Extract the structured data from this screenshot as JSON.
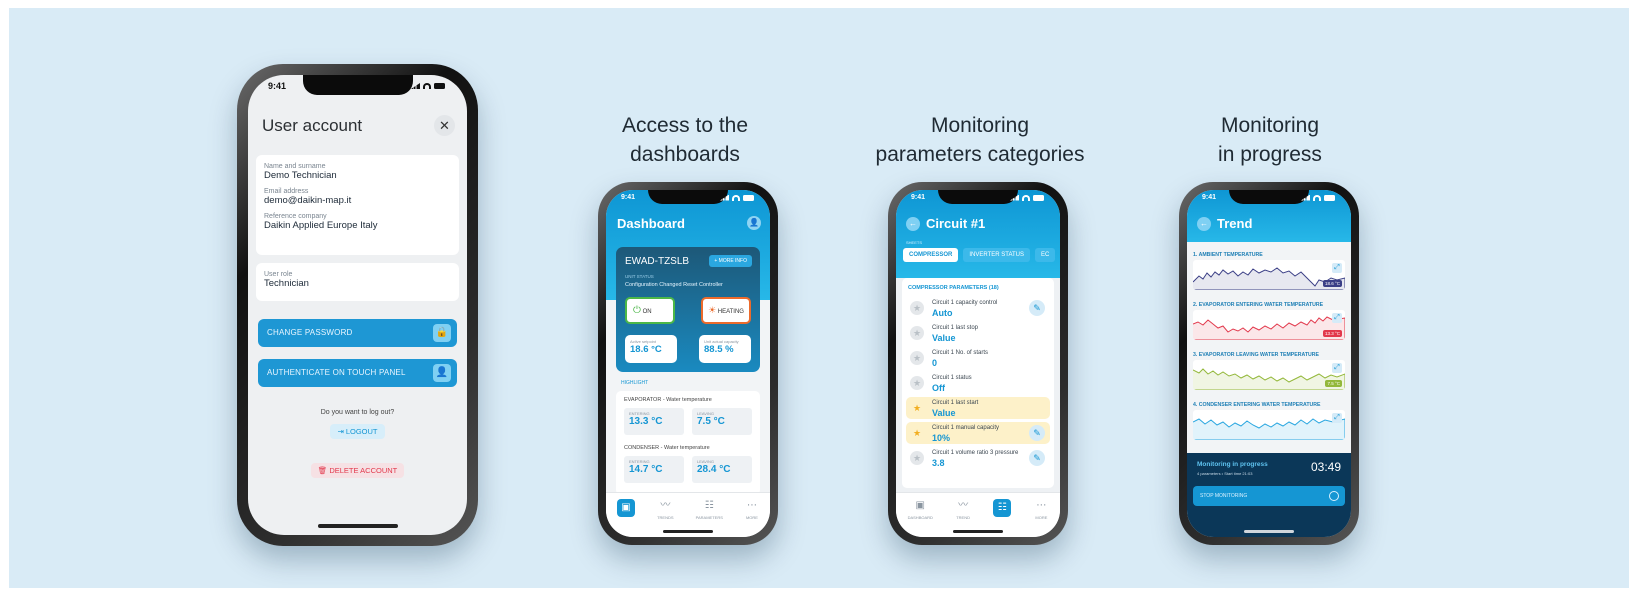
{
  "captions": {
    "c2": [
      "Access to the",
      "dashboards"
    ],
    "c3": [
      "Monitoring",
      "parameters categories"
    ],
    "c4": [
      "Monitoring",
      "in progress"
    ]
  },
  "colors": {
    "background": "#d9ebf6",
    "accent": "#1596d3",
    "danger": "#e2384c",
    "favorite": "#fdf1c9"
  },
  "phone1": {
    "time": "9:41",
    "title": "User account",
    "close_icon": "close-icon",
    "fields": [
      {
        "label": "Name and surname",
        "value": "Demo Technician"
      },
      {
        "label": "Email address",
        "value": "demo@daikin-map.it"
      },
      {
        "label": "Reference company",
        "value": "Daikin Applied Europe Italy"
      }
    ],
    "role": {
      "label": "User role",
      "value": "Technician"
    },
    "change_password": "CHANGE PASSWORD",
    "authenticate": "AUTHENTICATE ON TOUCH PANEL",
    "logout_question": "Do you want to log out?",
    "logout": "LOGOUT",
    "delete_account": "DELETE ACCOUNT"
  },
  "phone2": {
    "time": "9:41",
    "title": "Dashboard",
    "unit_name": "EWAD-TZSLB",
    "more_info": "+ MORE INFO",
    "unit_status_label": "UNIT STATUS",
    "unit_status": "Configuration Changed Reset Controller",
    "on": "ON",
    "heating": "HEATING",
    "active_setpoint_label": "Active setpoint",
    "active_setpoint": "18.6 °C",
    "capacity_label": "Unit actual capacity",
    "capacity": "88.5 %",
    "highlight": "HIGHLIGHT",
    "evaporator_title": "EVAPORATOR - Water temperature",
    "entering_label": "ENTERING",
    "leaving_label": "LEAVING",
    "evap_entering": "13.3 °C",
    "evap_leaving": "7.5 °C",
    "condenser_title": "CONDENSER - Water temperature",
    "cond_entering": "14.7 °C",
    "cond_leaving": "28.4 °C",
    "nav": [
      "",
      "TRENDS",
      "PARAMETERS",
      "MORE"
    ]
  },
  "phone3": {
    "time": "9:41",
    "title": "Circuit #1",
    "sheets_label": "SHEETS",
    "tabs": [
      "COMPRESSOR",
      "INVERTER STATUS",
      "EC"
    ],
    "section": "COMPRESSOR PARAMETERS (18)",
    "params": [
      {
        "label": "Circuit 1 capacity control",
        "value": "Auto"
      },
      {
        "label": "Circuit 1 last stop",
        "value": "Value"
      },
      {
        "label": "Circuit 1 No. of starts",
        "value": "0"
      },
      {
        "label": "Circuit 1 status",
        "value": "Off"
      },
      {
        "label": "Circuit 1 last start",
        "value": "Value"
      },
      {
        "label": "Circuit 1 manual capacity",
        "value": "10%"
      },
      {
        "label": "Circuit 1 volume ratio 3 pressure",
        "value": "3.8"
      }
    ],
    "nav": [
      "DASHBOARD",
      "TREND",
      "",
      "MORE"
    ]
  },
  "phone4": {
    "time": "9:41",
    "title": "Trend",
    "trends": [
      {
        "label": "1. AMBIENT TEMPERATURE",
        "tag": "18.6 °C",
        "color": "#3b3f86"
      },
      {
        "label": "2. EVAPORATOR ENTERING WATER TEMPERATURE",
        "tag": "13.3 °C",
        "color": "#e2384c"
      },
      {
        "label": "3. EVAPORATOR LEAVING WATER TEMPERATURE",
        "tag": "7.5 °C",
        "color": "#93b83a"
      },
      {
        "label": "4. CONDENSER ENTERING WATER TEMPERATURE",
        "tag": "",
        "color": "#2aa7e0"
      }
    ],
    "monitoring_title": "Monitoring in progress",
    "monitoring_sub": "4 parameters  •  Start time 21:03",
    "timer": "03:49",
    "stop": "STOP MONITORING"
  }
}
